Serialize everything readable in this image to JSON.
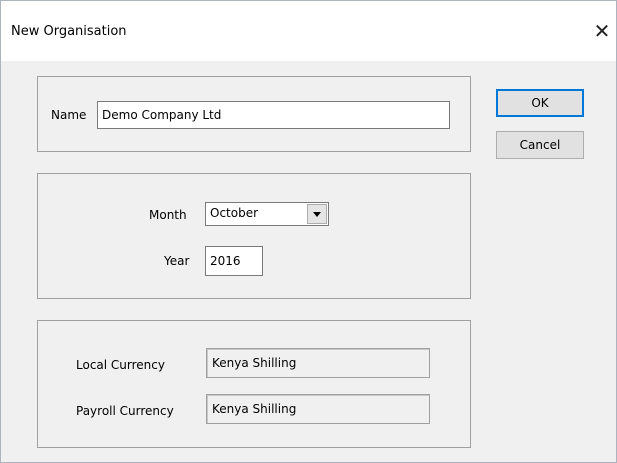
{
  "window": {
    "title": "New Organisation",
    "close_glyph": "✕"
  },
  "name_group": {
    "name_label": "Name",
    "name_value": "Demo Company Ltd"
  },
  "period_group": {
    "month_label": "Month",
    "month_value": "October",
    "year_label": "Year",
    "year_value": "2016"
  },
  "currency_group": {
    "local_label": "Local Currency",
    "local_value": "Kenya Shilling",
    "payroll_label": "Payroll Currency",
    "payroll_value": "Kenya Shilling"
  },
  "buttons": {
    "ok_label": "OK",
    "cancel_label": "Cancel"
  }
}
